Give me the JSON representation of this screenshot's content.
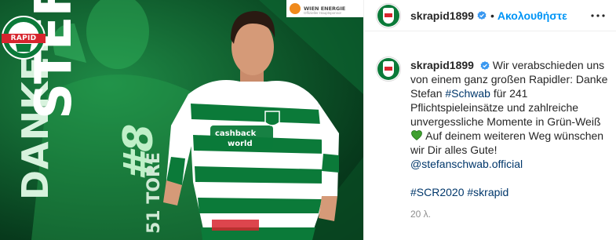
{
  "post": {
    "image": {
      "thank_you_text": "DANKE!",
      "player_name": "STEFAN",
      "player_number": "#8",
      "goals_text": "51 TORE",
      "club_badge_text": "RAPID",
      "sponsor_name": "WIEN ENERGIE",
      "sponsor_subtitle": "Offizieller Hauptsponsor"
    }
  },
  "header": {
    "username": "skrapid1899",
    "verified_icon": "verified-badge-icon",
    "separator": "•",
    "follow_label": "Ακολουθήστε",
    "more_icon": "more-options-icon"
  },
  "caption": {
    "username": "skrapid1899",
    "text_1": "Wir verabschieden uns von einem ganz großen Rapidler: Danke Stefan ",
    "hashtag_schwab": "#Schwab",
    "text_2": " für 241 Pflichtspieleinsätze und zahlreiche unvergessliche Momente in Grün-Weiß ",
    "emoji": "green-heart-icon",
    "text_3": " Auf deinem weiteren Weg wünschen wir Dir alles Gute! ",
    "mention": "@stefanschwab.official",
    "hashtag_1": "#SCR2020",
    "hashtag_2": "#skrapid",
    "timestamp": "20 λ."
  },
  "colors": {
    "accent_blue": "#0095f6",
    "link_blue": "#00376b",
    "club_green": "#0b7a39",
    "club_red": "#d7252e",
    "muted_text": "#8e8e8e"
  }
}
